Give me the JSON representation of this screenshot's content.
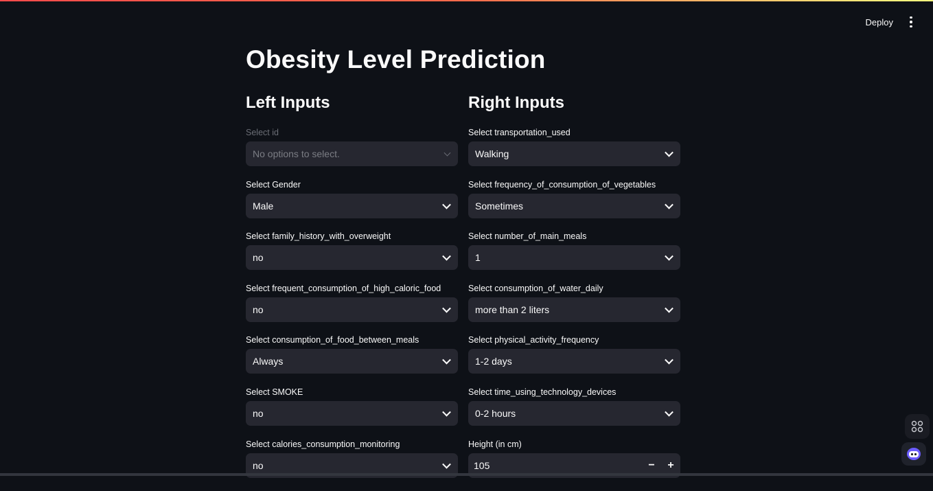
{
  "header": {
    "deploy_label": "Deploy",
    "menu_icon": "kebab-menu-icon"
  },
  "page": {
    "title": "Obesity Level Prediction"
  },
  "left": {
    "heading": "Left Inputs",
    "fields": [
      {
        "label": "Select id",
        "value": "No options to select.",
        "disabled": true
      },
      {
        "label": "Select Gender",
        "value": "Male"
      },
      {
        "label": "Select family_history_with_overweight",
        "value": "no"
      },
      {
        "label": "Select frequent_consumption_of_high_caloric_food",
        "value": "no"
      },
      {
        "label": "Select consumption_of_food_between_meals",
        "value": "Always"
      },
      {
        "label": "Select SMOKE",
        "value": "no"
      },
      {
        "label": "Select calories_consumption_monitoring",
        "value": "no"
      }
    ]
  },
  "right": {
    "heading": "Right Inputs",
    "fields": [
      {
        "label": "Select transportation_used",
        "value": "Walking"
      },
      {
        "label": "Select frequency_of_consumption_of_vegetables",
        "value": "Sometimes"
      },
      {
        "label": "Select number_of_main_meals",
        "value": "1"
      },
      {
        "label": "Select consumption_of_water_daily",
        "value": "more than 2 liters"
      },
      {
        "label": "Select physical_activity_frequency",
        "value": "1-2 days"
      },
      {
        "label": "Select time_using_technology_devices",
        "value": "0-2 hours"
      },
      {
        "label": "Height (in cm)",
        "value": "105",
        "minus": "−",
        "plus": "+"
      }
    ]
  },
  "colors": {
    "background": "#0e1117",
    "input_bg": "#262730",
    "accent": "#ff4b4b"
  }
}
